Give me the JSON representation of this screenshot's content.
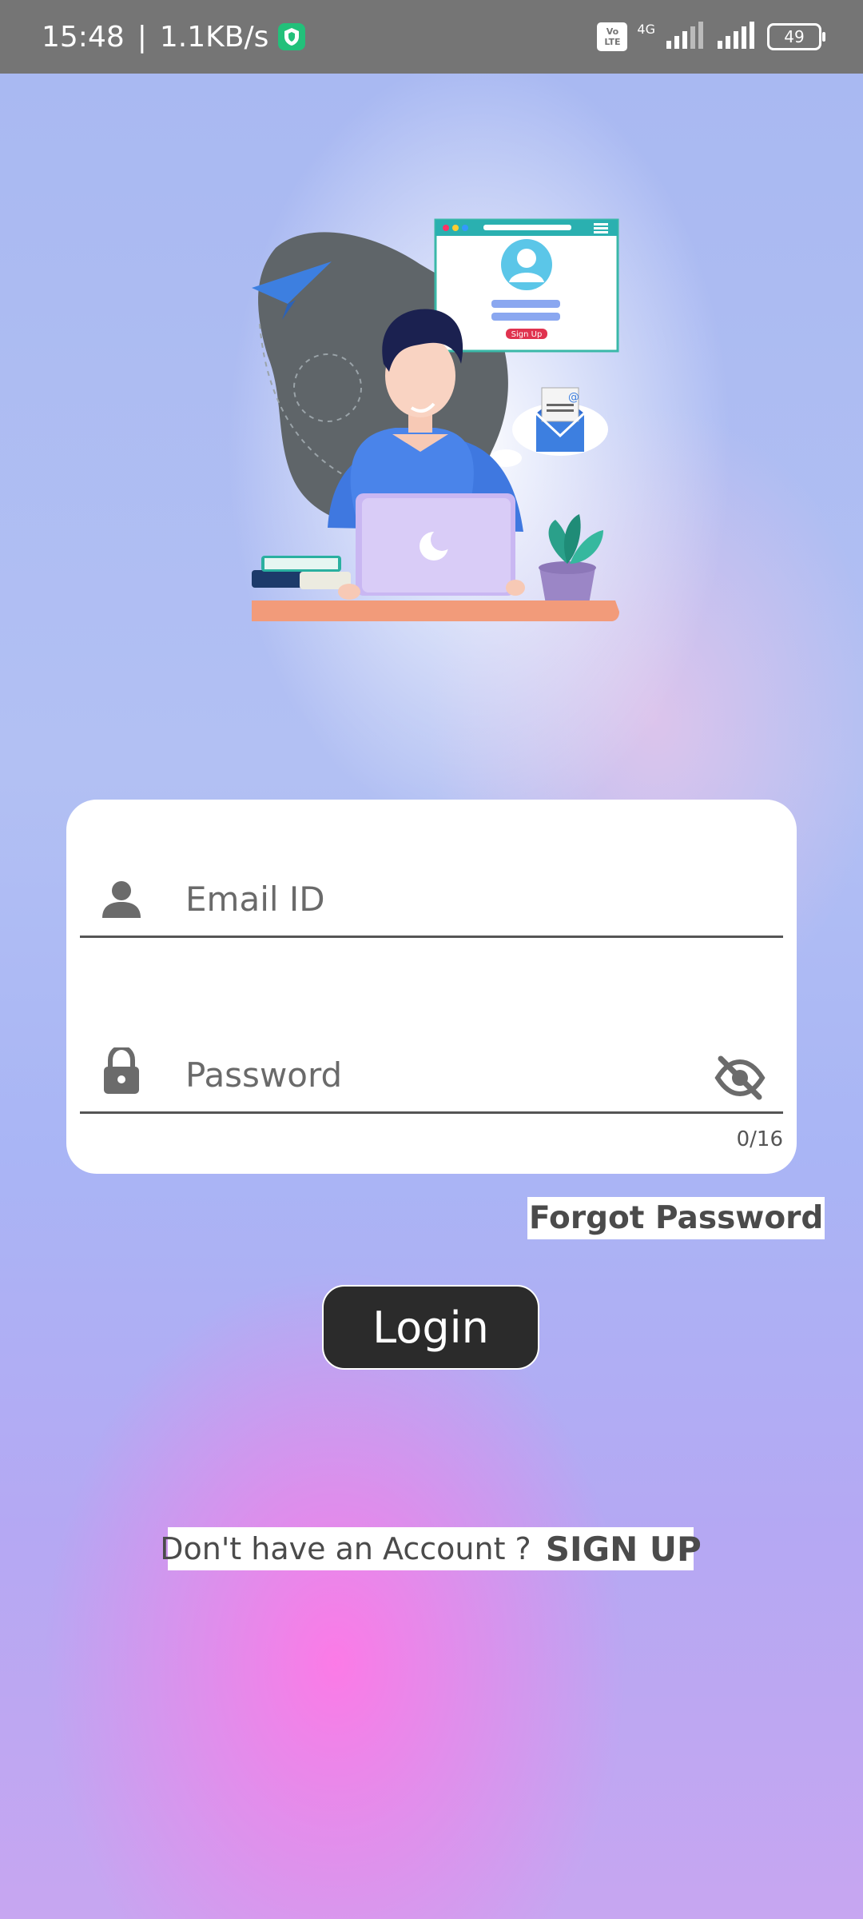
{
  "status_bar": {
    "time": "15:48",
    "separator": "|",
    "net_speed": "1.1KB/s",
    "volte_top": "Vo",
    "volte_bottom": "LTE",
    "network_type": "4G",
    "battery": "49"
  },
  "illustration": {
    "browser_button": "Sign Up"
  },
  "login_form": {
    "email_placeholder": "Email ID",
    "password_placeholder": "Password",
    "password_counter": "0/16",
    "forgot_password": "Forgot Password",
    "login_button": "Login",
    "no_account_text": "Don't have an Account ?",
    "signup_link": "SIGN UP"
  },
  "colors": {
    "status_bar": "#757575",
    "button_bg": "#2b2b2b",
    "card": "#ffffff",
    "shield": "#22c07a"
  }
}
